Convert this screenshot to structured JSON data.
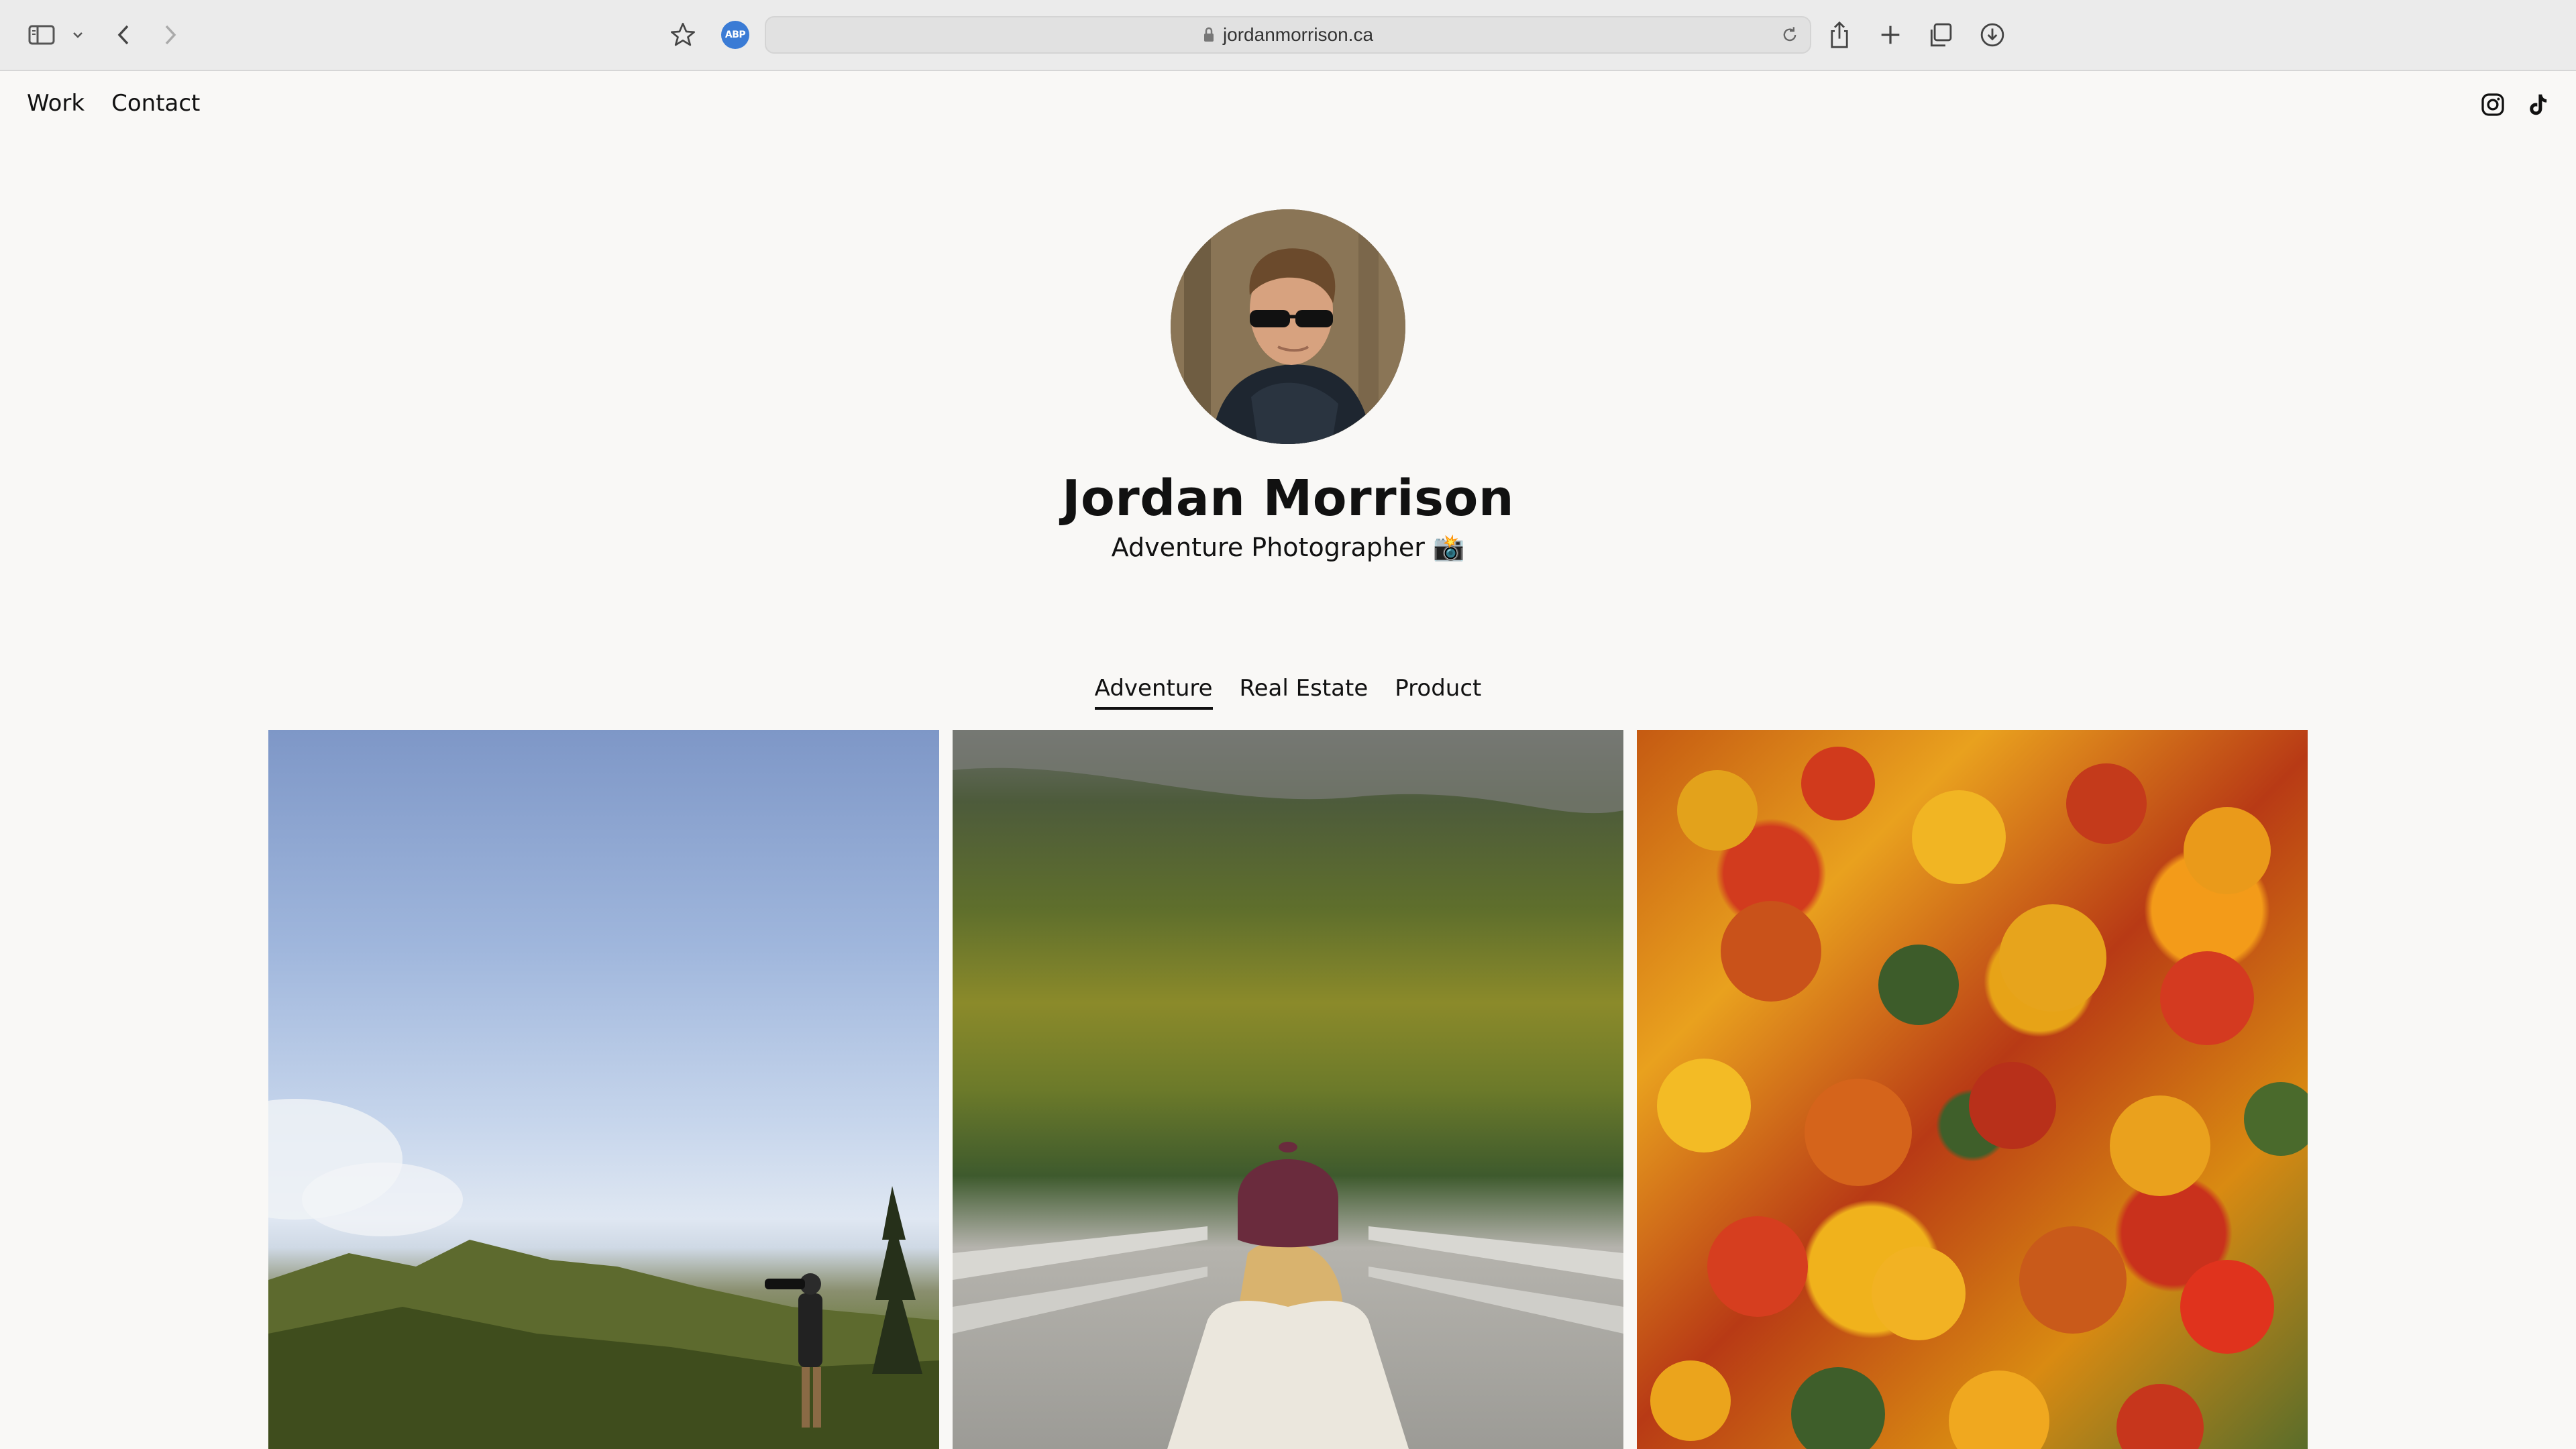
{
  "browser": {
    "url": "jordanmorrison.ca",
    "extension_badge": "ABP",
    "icons": [
      "sidebar-icon",
      "chevron-down-icon",
      "back-icon",
      "forward-icon",
      "star-icon",
      "lock-icon",
      "reload-icon",
      "share-icon",
      "plus-icon",
      "tabs-icon",
      "download-icon"
    ]
  },
  "nav": {
    "work": "Work",
    "contact": "Contact"
  },
  "social": {
    "icons": [
      "instagram-icon",
      "tiktok-icon"
    ]
  },
  "profile": {
    "name": "Jordan Morrison",
    "tagline": "Adventure Photographer 📸"
  },
  "tabs": [
    {
      "label": "Adventure",
      "active": true
    },
    {
      "label": "Real Estate",
      "active": false
    },
    {
      "label": "Product",
      "active": false
    }
  ],
  "gallery": [
    "mountain-photographer-photo",
    "woman-on-bridge-photo",
    "autumn-forest-aerial-photo"
  ]
}
